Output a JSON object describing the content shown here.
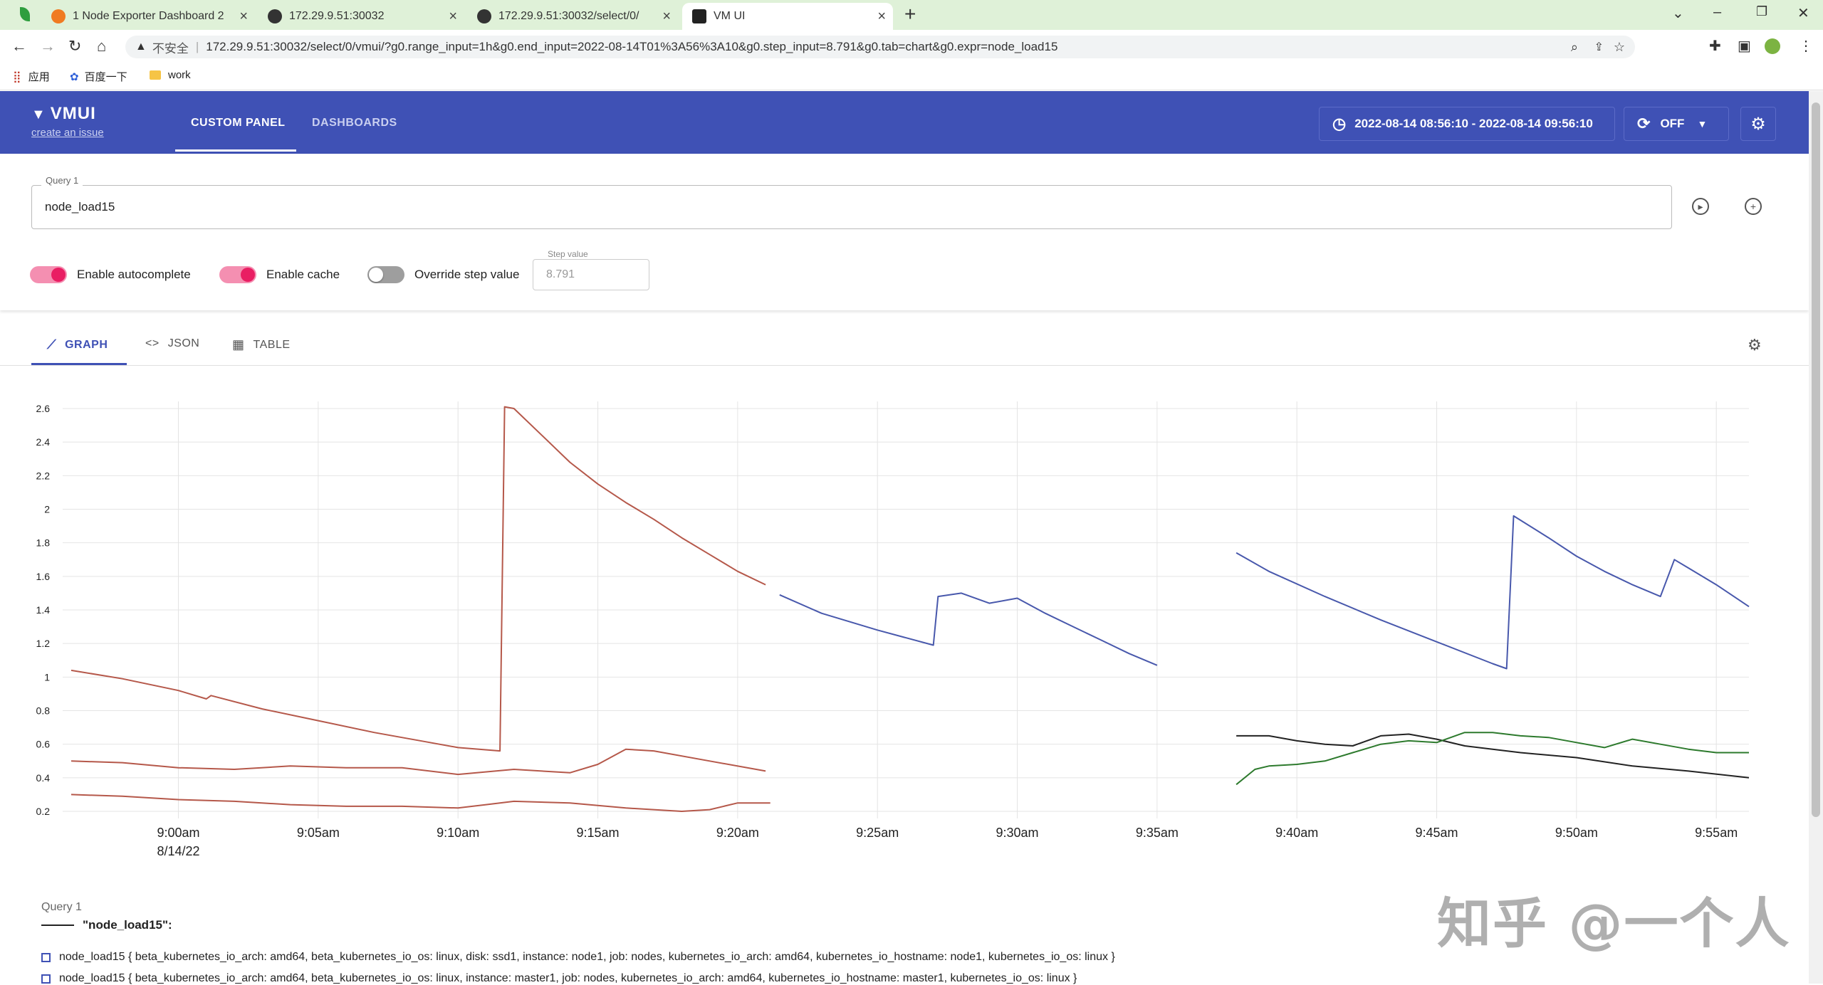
{
  "browser": {
    "tabs": [
      {
        "title": "1 Node Exporter Dashboard 2",
        "active": false
      },
      {
        "title": "172.29.9.51:30032",
        "active": false
      },
      {
        "title": "172.29.9.51:30032/select/0/",
        "active": false
      },
      {
        "title": "VM UI",
        "active": true
      }
    ],
    "security_label": "不安全",
    "url": "172.29.9.51:30032/select/0/vmui/?g0.range_input=1h&g0.end_input=2022-08-14T01%3A56%3A10&g0.step_input=8.791&g0.tab=chart&g0.expr=node_load15",
    "bookmarks": [
      "应用",
      "百度一下",
      "work"
    ]
  },
  "header": {
    "logo": "VMUI",
    "issue_link": "create an issue",
    "nav": [
      "CUSTOM PANEL",
      "DASHBOARDS"
    ],
    "time_range": "2022-08-14 08:56:10 - 2022-08-14 09:56:10",
    "refresh": "OFF"
  },
  "query": {
    "label": "Query 1",
    "value": "node_load15",
    "toggles": [
      {
        "label": "Enable autocomplete",
        "on": true
      },
      {
        "label": "Enable cache",
        "on": true
      },
      {
        "label": "Override step value",
        "on": false
      }
    ],
    "step_label": "Step value",
    "step_value": "8.791"
  },
  "view_tabs": [
    "GRAPH",
    "JSON",
    "TABLE"
  ],
  "chart_data": {
    "type": "line",
    "ylim": [
      0.2,
      2.6
    ],
    "yticks": [
      0.2,
      0.4,
      0.6,
      0.8,
      1,
      1.2,
      1.4,
      1.6,
      1.8,
      2,
      2.2,
      2.4,
      2.6
    ],
    "xlim": [
      "08:56:10",
      "09:56:10"
    ],
    "x_ticks": [
      "9:00am",
      "9:05am",
      "9:10am",
      "9:15am",
      "9:20am",
      "9:25am",
      "9:30am",
      "9:35am",
      "9:40am",
      "9:45am",
      "9:50am",
      "9:55am"
    ],
    "x_sublabel": "8/14/22",
    "series": [
      {
        "color": "#b5584a",
        "points": [
          [
            "08:56:10",
            1.04
          ],
          [
            "08:58:00",
            0.99
          ],
          [
            "09:00:00",
            0.92
          ],
          [
            "09:01:00",
            0.87
          ],
          [
            "09:01:10",
            0.89
          ],
          [
            "09:03:00",
            0.81
          ],
          [
            "09:05:00",
            0.74
          ],
          [
            "09:07:00",
            0.67
          ],
          [
            "09:09:00",
            0.61
          ],
          [
            "09:10:00",
            0.58
          ],
          [
            "09:11:30",
            0.56
          ],
          [
            "09:11:40",
            2.61
          ],
          [
            "09:12:00",
            2.6
          ],
          [
            "09:13:00",
            2.44
          ],
          [
            "09:14:00",
            2.28
          ],
          [
            "09:15:00",
            2.15
          ],
          [
            "09:16:00",
            2.04
          ],
          [
            "09:17:00",
            1.94
          ],
          [
            "09:18:00",
            1.83
          ],
          [
            "09:19:00",
            1.73
          ],
          [
            "09:20:00",
            1.63
          ],
          [
            "09:21:00",
            1.55
          ]
        ]
      },
      {
        "color": "#b5584a",
        "points": [
          [
            "08:56:10",
            0.5
          ],
          [
            "08:58:00",
            0.49
          ],
          [
            "09:00:00",
            0.46
          ],
          [
            "09:02:00",
            0.45
          ],
          [
            "09:04:00",
            0.47
          ],
          [
            "09:06:00",
            0.46
          ],
          [
            "09:08:00",
            0.46
          ],
          [
            "09:10:00",
            0.42
          ],
          [
            "09:12:00",
            0.45
          ],
          [
            "09:14:00",
            0.43
          ],
          [
            "09:15:00",
            0.48
          ],
          [
            "09:16:00",
            0.57
          ],
          [
            "09:17:00",
            0.56
          ],
          [
            "09:19:00",
            0.5
          ],
          [
            "09:21:00",
            0.44
          ]
        ]
      },
      {
        "color": "#b5584a",
        "points": [
          [
            "08:56:10",
            0.3
          ],
          [
            "08:58:00",
            0.29
          ],
          [
            "09:00:00",
            0.27
          ],
          [
            "09:02:00",
            0.26
          ],
          [
            "09:04:00",
            0.24
          ],
          [
            "09:06:00",
            0.23
          ],
          [
            "09:08:00",
            0.23
          ],
          [
            "09:10:00",
            0.22
          ],
          [
            "09:11:00",
            0.24
          ],
          [
            "09:12:00",
            0.26
          ],
          [
            "09:14:00",
            0.25
          ],
          [
            "09:16:00",
            0.22
          ],
          [
            "09:18:00",
            0.2
          ],
          [
            "09:19:00",
            0.21
          ],
          [
            "09:20:00",
            0.25
          ],
          [
            "09:21:10",
            0.25
          ]
        ]
      },
      {
        "color": "#4858ac",
        "points": [
          [
            "09:21:30",
            1.49
          ],
          [
            "09:23:00",
            1.38
          ],
          [
            "09:25:00",
            1.28
          ],
          [
            "09:27:00",
            1.19
          ],
          [
            "09:27:10",
            1.48
          ],
          [
            "09:28:00",
            1.5
          ],
          [
            "09:29:00",
            1.44
          ],
          [
            "09:30:00",
            1.47
          ],
          [
            "09:31:00",
            1.38
          ],
          [
            "09:32:00",
            1.3
          ],
          [
            "09:33:00",
            1.22
          ],
          [
            "09:34:00",
            1.14
          ],
          [
            "09:35:00",
            1.07
          ]
        ]
      },
      {
        "color": "#4858ac",
        "points": [
          [
            "09:37:50",
            1.74
          ],
          [
            "09:39:00",
            1.63
          ],
          [
            "09:41:00",
            1.48
          ],
          [
            "09:43:00",
            1.34
          ],
          [
            "09:45:00",
            1.21
          ],
          [
            "09:47:00",
            1.08
          ],
          [
            "09:47:30",
            1.05
          ],
          [
            "09:47:45",
            1.96
          ],
          [
            "09:49:00",
            1.83
          ],
          [
            "09:50:00",
            1.72
          ],
          [
            "09:51:00",
            1.63
          ],
          [
            "09:52:00",
            1.55
          ],
          [
            "09:53:00",
            1.48
          ],
          [
            "09:53:30",
            1.7
          ],
          [
            "09:54:00",
            1.65
          ],
          [
            "09:55:00",
            1.55
          ],
          [
            "09:56:10",
            1.42
          ]
        ]
      },
      {
        "color": "#222222",
        "points": [
          [
            "09:37:50",
            0.65
          ],
          [
            "09:39:00",
            0.65
          ],
          [
            "09:40:00",
            0.62
          ],
          [
            "09:41:00",
            0.6
          ],
          [
            "09:42:00",
            0.59
          ],
          [
            "09:43:00",
            0.65
          ],
          [
            "09:44:00",
            0.66
          ],
          [
            "09:45:00",
            0.63
          ],
          [
            "09:46:00",
            0.59
          ],
          [
            "09:48:00",
            0.55
          ],
          [
            "09:50:00",
            0.52
          ],
          [
            "09:52:00",
            0.47
          ],
          [
            "09:54:00",
            0.44
          ],
          [
            "09:56:10",
            0.4
          ]
        ]
      },
      {
        "color": "#2d7a2d",
        "points": [
          [
            "09:37:50",
            0.36
          ],
          [
            "09:38:30",
            0.45
          ],
          [
            "09:39:00",
            0.47
          ],
          [
            "09:40:00",
            0.48
          ],
          [
            "09:41:00",
            0.5
          ],
          [
            "09:42:00",
            0.55
          ],
          [
            "09:43:00",
            0.6
          ],
          [
            "09:44:00",
            0.62
          ],
          [
            "09:45:00",
            0.61
          ],
          [
            "09:46:00",
            0.67
          ],
          [
            "09:47:00",
            0.67
          ],
          [
            "09:48:00",
            0.65
          ],
          [
            "09:49:00",
            0.64
          ],
          [
            "09:50:00",
            0.61
          ],
          [
            "09:51:00",
            0.58
          ],
          [
            "09:52:00",
            0.63
          ],
          [
            "09:53:00",
            0.6
          ],
          [
            "09:54:00",
            0.57
          ],
          [
            "09:55:00",
            0.55
          ],
          [
            "09:56:10",
            0.55
          ]
        ]
      }
    ]
  },
  "legend": {
    "query_label": "Query 1",
    "expr": "\"node_load15\":",
    "items": [
      "node_load15 { beta_kubernetes_io_arch: amd64,  beta_kubernetes_io_os: linux,  disk: ssd1,  instance: node1,  job: nodes,  kubernetes_io_arch: amd64,  kubernetes_io_hostname: node1,  kubernetes_io_os: linux }",
      "node_load15 { beta_kubernetes_io_arch: amd64,  beta_kubernetes_io_os: linux,  instance: master1,  job: nodes,  kubernetes_io_arch: amd64,  kubernetes_io_hostname: master1,  kubernetes_io_os: linux }"
    ]
  },
  "watermark": "知乎 @一个人"
}
